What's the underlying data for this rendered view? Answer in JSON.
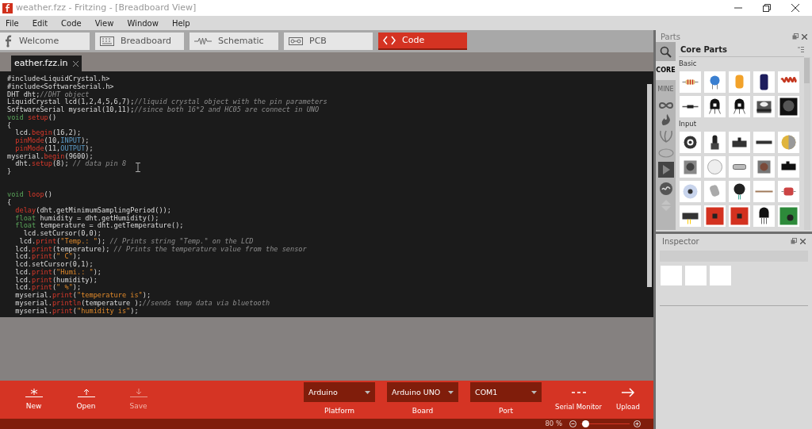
{
  "window": {
    "title": "weather.fzz - Fritzing - [Breadboard View]"
  },
  "menu": [
    "File",
    "Edit",
    "Code",
    "View",
    "Window",
    "Help"
  ],
  "view_tabs": [
    {
      "kind": "welcome",
      "label": "Welcome",
      "selected": false
    },
    {
      "kind": "breadboard",
      "label": "Breadboard",
      "selected": false
    },
    {
      "kind": "schematic",
      "label": "Schematic",
      "selected": false
    },
    {
      "kind": "pcb",
      "label": "PCB",
      "selected": false
    },
    {
      "kind": "code",
      "label": "Code",
      "selected": true
    }
  ],
  "file_tab": {
    "label": "eather.fzz.in"
  },
  "code_blocks": [
    {
      "lines": [
        [
          {
            "kind": "plain",
            "text": "#include<LiquidCrystal.h>"
          }
        ],
        [
          {
            "kind": "plain",
            "text": "#include<SoftwareSerial.h>"
          }
        ],
        [
          {
            "kind": "plain",
            "text": "DHT dht;"
          },
          {
            "kind": "comment",
            "text": "//DHT object"
          }
        ],
        [
          {
            "kind": "plain",
            "text": "LiquidCrystal lcd(1,2,4,5,6,7);"
          },
          {
            "kind": "comment",
            "text": "//liquid crystal object with the pin parameters"
          }
        ],
        [
          {
            "kind": "plain",
            "text": "SoftwareSerial myserial(10,11);"
          },
          {
            "kind": "comment",
            "text": "//since both 16*2 and HC05 are connect in UNO"
          }
        ],
        [
          {
            "kind": "keyword",
            "text": "void "
          },
          {
            "kind": "function",
            "text": "setup"
          },
          {
            "kind": "plain",
            "text": "()"
          }
        ],
        [
          {
            "kind": "plain",
            "text": "{"
          }
        ],
        [
          {
            "kind": "plain",
            "text": "  lcd."
          },
          {
            "kind": "function",
            "text": "begin"
          },
          {
            "kind": "plain",
            "text": "(16,2);"
          }
        ],
        [
          {
            "kind": "function",
            "text": "  pinMode"
          },
          {
            "kind": "plain",
            "text": "(10,"
          },
          {
            "kind": "constant",
            "text": "INPUT"
          },
          {
            "kind": "plain",
            "text": ");"
          }
        ],
        [
          {
            "kind": "function",
            "text": "  pinMode"
          },
          {
            "kind": "plain",
            "text": "(11,"
          },
          {
            "kind": "constant",
            "text": "OUTPUT"
          },
          {
            "kind": "plain",
            "text": ");"
          }
        ],
        [
          {
            "kind": "plain",
            "text": "myserial."
          },
          {
            "kind": "function",
            "text": "begin"
          },
          {
            "kind": "plain",
            "text": "(9600);"
          }
        ],
        [
          {
            "kind": "plain",
            "text": "  dht."
          },
          {
            "kind": "function",
            "text": "setup"
          },
          {
            "kind": "plain",
            "text": "(8); "
          },
          {
            "kind": "comment",
            "text": "// data pin 8"
          }
        ],
        [
          {
            "kind": "plain",
            "text": "}"
          }
        ]
      ]
    },
    {
      "lines": [
        [
          {
            "kind": "keyword",
            "text": "void "
          },
          {
            "kind": "function",
            "text": "loop"
          },
          {
            "kind": "plain",
            "text": "()"
          }
        ],
        [
          {
            "kind": "plain",
            "text": "{"
          }
        ],
        [
          {
            "kind": "function",
            "text": "  delay"
          },
          {
            "kind": "plain",
            "text": "(dht.getMinimumSamplingPeriod());"
          }
        ],
        [
          {
            "kind": "keyword",
            "text": "  float"
          },
          {
            "kind": "plain",
            "text": " humidity = dht.getHumidity();"
          }
        ],
        [
          {
            "kind": "keyword",
            "text": "  float"
          },
          {
            "kind": "plain",
            "text": " temperature = dht.getTemperature();"
          }
        ],
        [
          {
            "kind": "plain",
            "text": "    lcd.setCursor(0,0);"
          }
        ],
        [
          {
            "kind": "plain",
            "text": "   lcd."
          },
          {
            "kind": "function",
            "text": "print"
          },
          {
            "kind": "plain",
            "text": "("
          },
          {
            "kind": "string",
            "text": "\"Temp.: \""
          },
          {
            "kind": "plain",
            "text": "); "
          },
          {
            "kind": "comment",
            "text": "// Prints string \"Temp.\" on the LCD"
          }
        ],
        [
          {
            "kind": "plain",
            "text": "  lcd."
          },
          {
            "kind": "function",
            "text": "print"
          },
          {
            "kind": "plain",
            "text": "(temperature); "
          },
          {
            "kind": "comment",
            "text": "// Prints the temperature value from the sensor"
          }
        ],
        [
          {
            "kind": "plain",
            "text": "  lcd."
          },
          {
            "kind": "function",
            "text": "print"
          },
          {
            "kind": "plain",
            "text": "("
          },
          {
            "kind": "string",
            "text": "\" C\""
          },
          {
            "kind": "plain",
            "text": ");"
          }
        ],
        [
          {
            "kind": "plain",
            "text": "  lcd.setCursor(0,1);"
          }
        ],
        [
          {
            "kind": "plain",
            "text": "  lcd."
          },
          {
            "kind": "function",
            "text": "print"
          },
          {
            "kind": "plain",
            "text": "("
          },
          {
            "kind": "string",
            "text": "\"Humi.: \""
          },
          {
            "kind": "plain",
            "text": ");"
          }
        ],
        [
          {
            "kind": "plain",
            "text": "  lcd."
          },
          {
            "kind": "function",
            "text": "print"
          },
          {
            "kind": "plain",
            "text": "(humidity);"
          }
        ],
        [
          {
            "kind": "plain",
            "text": "  lcd."
          },
          {
            "kind": "function",
            "text": "print"
          },
          {
            "kind": "plain",
            "text": "("
          },
          {
            "kind": "string",
            "text": "\" %\""
          },
          {
            "kind": "plain",
            "text": ");"
          }
        ],
        [
          {
            "kind": "plain",
            "text": "  myserial."
          },
          {
            "kind": "function",
            "text": "print"
          },
          {
            "kind": "plain",
            "text": "("
          },
          {
            "kind": "string",
            "text": "\"temperature is\""
          },
          {
            "kind": "plain",
            "text": ");"
          }
        ],
        [
          {
            "kind": "plain",
            "text": "  myserial."
          },
          {
            "kind": "function",
            "text": "println"
          },
          {
            "kind": "plain",
            "text": "(temperature );"
          },
          {
            "kind": "comment",
            "text": "//sends temp data via bluetooth"
          }
        ],
        [
          {
            "kind": "plain",
            "text": "  myserial."
          },
          {
            "kind": "function",
            "text": "print"
          },
          {
            "kind": "plain",
            "text": "("
          },
          {
            "kind": "string",
            "text": "\"humidity is\""
          },
          {
            "kind": "plain",
            "text": ");"
          }
        ]
      ]
    }
  ],
  "toolbar": {
    "actions": [
      {
        "kind": "new",
        "label": "New",
        "disabled": false
      },
      {
        "kind": "open",
        "label": "Open",
        "disabled": false
      },
      {
        "kind": "save",
        "label": "Save",
        "disabled": true
      }
    ],
    "selects": [
      {
        "value": "Arduino",
        "label": "Platform"
      },
      {
        "value": "Arduino UNO",
        "label": "Board"
      },
      {
        "value": "COM1",
        "label": "Port"
      }
    ],
    "tools": [
      {
        "kind": "serial",
        "label": "Serial Monitor"
      },
      {
        "kind": "upload",
        "label": "Upload"
      }
    ]
  },
  "status_bar": {
    "zoom": "80 %",
    "zoom_slider": {
      "level": 0.04
    }
  },
  "parts": {
    "title": "Parts",
    "bins": [
      {
        "label": "CORE",
        "selected": true
      },
      {
        "label": "MINE",
        "selected": false
      }
    ],
    "bin_title": "Core Parts",
    "sections": [
      {
        "title": "Basic"
      },
      {
        "title": "Input"
      }
    ]
  },
  "inspector": {
    "title": "Inspector"
  }
}
